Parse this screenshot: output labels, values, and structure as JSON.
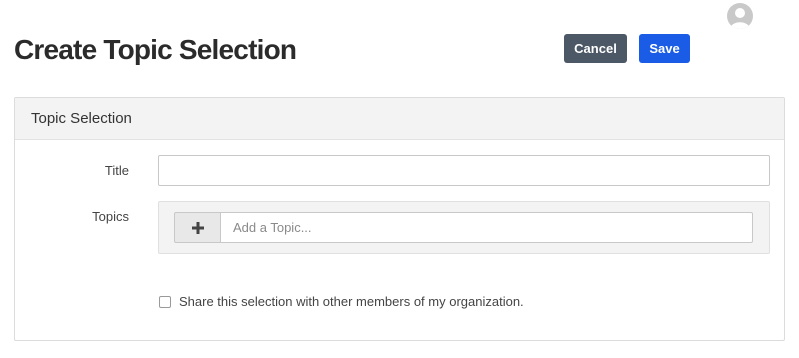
{
  "header": {
    "title": "Create Topic Selection",
    "cancel_label": "Cancel",
    "save_label": "Save",
    "avatar_icon": "user-avatar-icon"
  },
  "panel": {
    "heading": "Topic Selection",
    "title_field": {
      "label": "Title",
      "value": "",
      "placeholder": ""
    },
    "topics_field": {
      "label": "Topics",
      "add_icon": "plus-icon",
      "placeholder": "Add a Topic...",
      "value": ""
    },
    "share": {
      "label": "Share this selection with other members of my organization.",
      "checked": false
    }
  },
  "colors": {
    "cancel_button": "#4c5866",
    "save_button": "#1a5ce6",
    "panel_header_bg": "#f3f3f3"
  }
}
